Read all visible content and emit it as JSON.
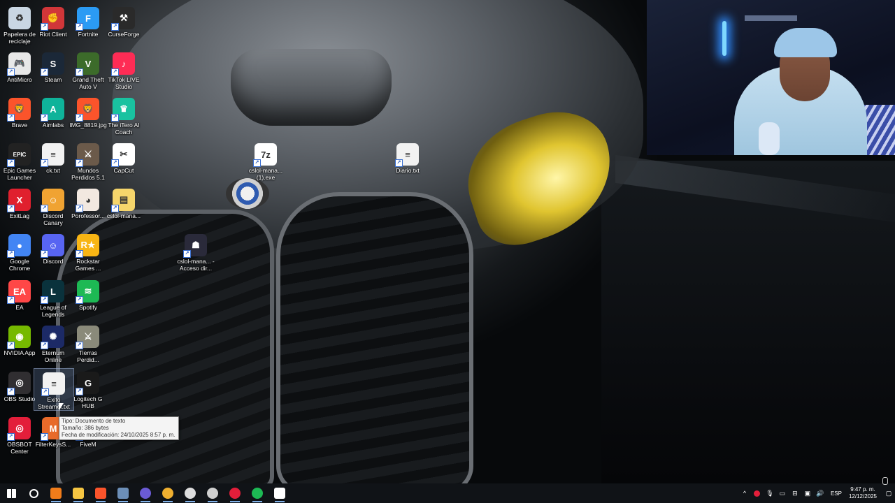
{
  "desktop": {
    "icons": [
      {
        "label": "Papelera de reciclaje",
        "icon": "recycle-bin-icon",
        "color": "#c9d6e3",
        "glyph": "♻"
      },
      {
        "label": "Riot Client",
        "icon": "riot-icon",
        "color": "#d13639",
        "glyph": "✊"
      },
      {
        "label": "Fortnite",
        "icon": "fortnite-icon",
        "color": "#2b9bf4",
        "glyph": "F"
      },
      {
        "label": "CurseForge",
        "icon": "curseforge-icon",
        "color": "#2a2a2a",
        "glyph": "⚒"
      },
      {
        "label": "AntiMicro",
        "icon": "gamepad-icon",
        "color": "#e8e8e8",
        "glyph": "🎮"
      },
      {
        "label": "Steam",
        "icon": "steam-icon",
        "color": "#1b2838",
        "glyph": "S"
      },
      {
        "label": "Grand Theft Auto V",
        "icon": "gta-icon",
        "color": "#3c6b2a",
        "glyph": "V"
      },
      {
        "label": "TikTok LIVE Studio",
        "icon": "tiktok-icon",
        "color": "#fe2c55",
        "glyph": "♪"
      },
      {
        "label": "Brave",
        "icon": "brave-icon",
        "color": "#fb542b",
        "glyph": "🦁"
      },
      {
        "label": "Aimlabs",
        "icon": "aimlabs-icon",
        "color": "#0fb39a",
        "glyph": "A"
      },
      {
        "label": "IMG_8819.jpg",
        "icon": "image-icon",
        "color": "#fb542b",
        "glyph": "🦁"
      },
      {
        "label": "The iTero AI Coach",
        "icon": "itero-icon",
        "color": "#19c2a0",
        "glyph": "♛"
      },
      {
        "label": "Epic Games Launcher",
        "icon": "epic-icon",
        "color": "#222222",
        "glyph": "EPIC"
      },
      {
        "label": "ck.txt",
        "icon": "text-file-icon",
        "color": "#f2f2f2",
        "glyph": "≡"
      },
      {
        "label": "Mundos Perdidos 5.1",
        "icon": "game-icon",
        "color": "#6b5a4a",
        "glyph": "⚔"
      },
      {
        "label": "CapCut",
        "icon": "capcut-icon",
        "color": "#ffffff",
        "glyph": "✂"
      },
      {
        "label": "ExitLag",
        "icon": "exitlag-icon",
        "color": "#e0202e",
        "glyph": "X"
      },
      {
        "label": "Discord Canary",
        "icon": "discord-canary-icon",
        "color": "#f0a332",
        "glyph": "☺"
      },
      {
        "label": "Porofessor...",
        "icon": "porofessor-icon",
        "color": "#f2e8e0",
        "glyph": "◕"
      },
      {
        "label": "cslol-mana...",
        "icon": "folder-icon",
        "color": "#f5d56b",
        "glyph": "▤"
      },
      {
        "label": "Google Chrome",
        "icon": "chrome-icon",
        "color": "#4285f4",
        "glyph": "●"
      },
      {
        "label": "Discord",
        "icon": "discord-icon",
        "color": "#5865f2",
        "glyph": "☺"
      },
      {
        "label": "Rockstar Games ...",
        "icon": "rockstar-icon",
        "color": "#f8b514",
        "glyph": "R★"
      },
      {
        "label": "EA",
        "icon": "ea-icon",
        "color": "#ff4747",
        "glyph": "EA"
      },
      {
        "label": "League of Legends",
        "icon": "lol-icon",
        "color": "#0a323c",
        "glyph": "L"
      },
      {
        "label": "Spotify",
        "icon": "spotify-icon",
        "color": "#1db954",
        "glyph": "≋"
      },
      {
        "label": "NVIDIA App",
        "icon": "nvidia-icon",
        "color": "#76b900",
        "glyph": "◉"
      },
      {
        "label": "Eternum Online",
        "icon": "eternum-icon",
        "color": "#1c2a66",
        "glyph": "✺"
      },
      {
        "label": "Tierras Perdid...",
        "icon": "game-icon",
        "color": "#8a8a7a",
        "glyph": "⚔"
      },
      {
        "label": "OBS Studio",
        "icon": "obs-icon",
        "color": "#302e31",
        "glyph": "◎"
      },
      {
        "label": "Exito Streamer.txt",
        "icon": "text-file-icon",
        "color": "#f2f2f2",
        "glyph": "≡"
      },
      {
        "label": "Logitech G HUB",
        "icon": "logitech-icon",
        "color": "#1a1a1a",
        "glyph": "G"
      },
      {
        "label": "OBSBOT Center",
        "icon": "obsbot-icon",
        "color": "#e31e3a",
        "glyph": "◎"
      },
      {
        "label": "FilterKeysS...",
        "icon": "filterkeys-icon",
        "color": "#e86a2a",
        "glyph": "M"
      },
      {
        "label": "FiveM",
        "icon": "fivem-icon",
        "color": "#f08a2a",
        "glyph": "⬢"
      },
      {
        "label": "cslol-mana... (1).exe",
        "icon": "7zip-icon",
        "color": "#ffffff",
        "glyph": "7z"
      },
      {
        "label": "Diario.txt",
        "icon": "text-file-icon",
        "color": "#f2f2f2",
        "glyph": "≡"
      },
      {
        "label": "cslol-mana... - Acceso dir...",
        "icon": "shortcut-icon",
        "color": "#2a2a3a",
        "glyph": "☗"
      }
    ]
  },
  "tooltip": {
    "line1": "Tipo: Documento de texto",
    "line2": "Tamaño: 386 bytes",
    "line3": "Fecha de modificación: 24/10/2025 8:57 p. m."
  },
  "taskbar": {
    "items": [
      {
        "name": "start-button",
        "icon": "windows-icon",
        "color": "#ffffff"
      },
      {
        "name": "search-button",
        "icon": "search-icon",
        "color": "#ffffff"
      },
      {
        "name": "taskbar-app-vlc",
        "icon": "app-icon",
        "color": "#f07c1a"
      },
      {
        "name": "taskbar-app-explorer",
        "icon": "folder-icon",
        "color": "#f5c542"
      },
      {
        "name": "taskbar-app-brave",
        "icon": "brave-icon",
        "color": "#fb542b"
      },
      {
        "name": "taskbar-app-calculator",
        "icon": "calculator-icon",
        "color": "#6c8fb8"
      },
      {
        "name": "taskbar-app-chrome-profile",
        "icon": "chrome-icon",
        "color": "#6b5bd6"
      },
      {
        "name": "taskbar-app-chrome",
        "icon": "chrome-icon",
        "color": "#f0b030"
      },
      {
        "name": "taskbar-app-settings-gear",
        "icon": "gear-icon",
        "color": "#dddddd"
      },
      {
        "name": "taskbar-app-obs",
        "icon": "obs-icon",
        "color": "#cfcfcf"
      },
      {
        "name": "taskbar-app-obsbot",
        "icon": "obsbot-icon",
        "color": "#e31e3a"
      },
      {
        "name": "taskbar-app-spotify",
        "icon": "spotify-icon",
        "color": "#1db954"
      },
      {
        "name": "taskbar-app-settings",
        "icon": "settings-icon",
        "color": "#ffffff"
      }
    ],
    "tray": {
      "language": "ESP",
      "time": "9:47 p. m.",
      "date": "12/12/2025"
    }
  }
}
